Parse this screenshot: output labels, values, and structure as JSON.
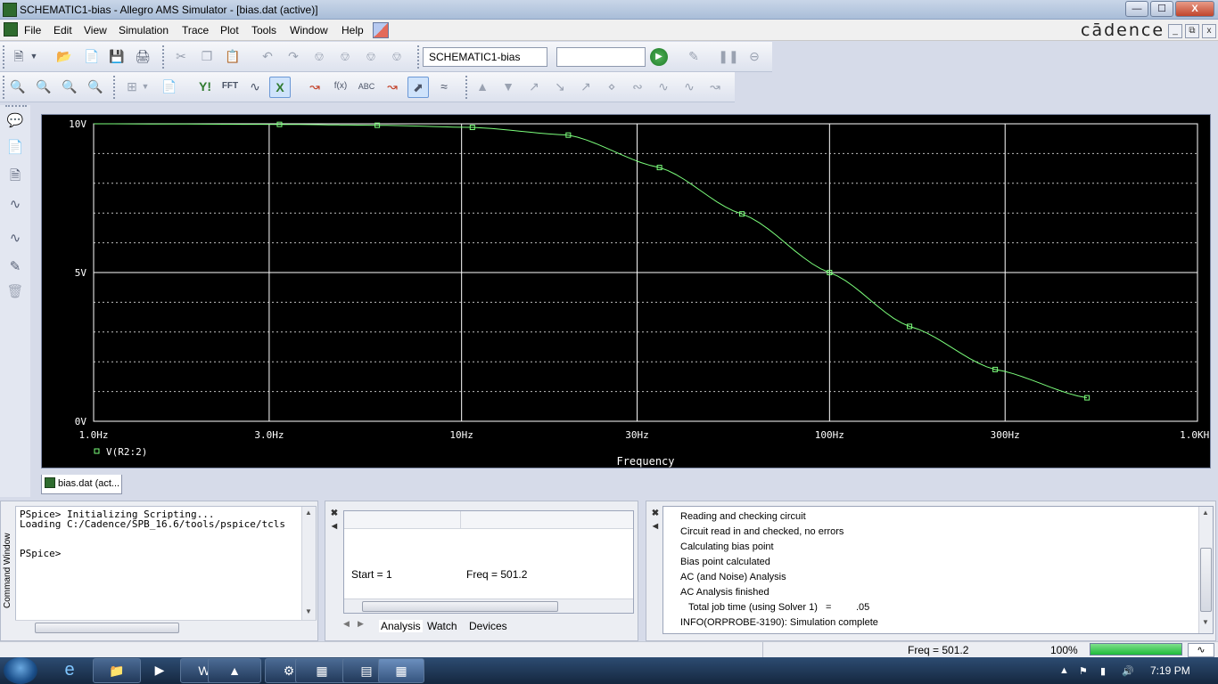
{
  "window": {
    "title": "SCHEMATIC1-bias - Allegro AMS Simulator - [bias.dat (active)]",
    "min_label": "—",
    "max_label": "☐",
    "close_label": "X",
    "brand": "cādence"
  },
  "menu": {
    "items": [
      "File",
      "Edit",
      "View",
      "Simulation",
      "Trace",
      "Plot",
      "Tools",
      "Window",
      "Help"
    ]
  },
  "toolbar": {
    "profile_combo": "SCHEMATIC1-bias",
    "run_combo": ""
  },
  "chart_data": {
    "type": "line",
    "xscale": "log",
    "xlim": [
      1,
      1000
    ],
    "ylim": [
      0,
      10
    ],
    "xlabel": "Frequency",
    "ylabel": "",
    "x_tick_labels": [
      "1.0Hz",
      "3.0Hz",
      "10Hz",
      "30Hz",
      "100Hz",
      "300Hz",
      "1.0KHz"
    ],
    "x_ticks": [
      1,
      3,
      10,
      30,
      100,
      300,
      1000
    ],
    "y_tick_labels": [
      "0V",
      "5V",
      "10V"
    ],
    "y_ticks": [
      0,
      5,
      10
    ],
    "series": [
      {
        "name": "V(R2:2)",
        "color": "#7cff7c",
        "x": [
          1,
          3.2,
          5.9,
          10.7,
          19.5,
          34.5,
          57.8,
          100,
          165,
          282,
          501
        ],
        "y": [
          10.0,
          9.98,
          9.95,
          9.88,
          9.62,
          8.53,
          6.97,
          5.0,
          3.19,
          1.74,
          0.79
        ]
      }
    ]
  },
  "doc_tab": {
    "label": "bias.dat (act..."
  },
  "command_window": {
    "side_label": "Command Window",
    "lines": [
      "PSpice> Initializing Scripting...",
      "Loading C:/Cadence/SPB_16.6/tools/pspice/tcls",
      "",
      "PSpice>"
    ]
  },
  "watch_window": {
    "start_label": "Start =  1",
    "freq_label": "Freq =  501.2",
    "tabs": [
      "Analysis",
      "Watch",
      "Devices"
    ]
  },
  "output_window": {
    "lines": [
      "Reading and checking circuit",
      "Circuit read in and checked, no errors",
      "Calculating bias point",
      "Bias point calculated",
      "AC (and Noise) Analysis",
      "AC Analysis finished",
      "   Total job time (using Solver 1)   =         .05",
      "INFO(ORPROBE-3190): Simulation complete"
    ]
  },
  "status": {
    "freq": "Freq =  501.2",
    "percent": "100%",
    "progress": 1.0
  },
  "taskbar": {
    "clock": "7:19 PM"
  }
}
